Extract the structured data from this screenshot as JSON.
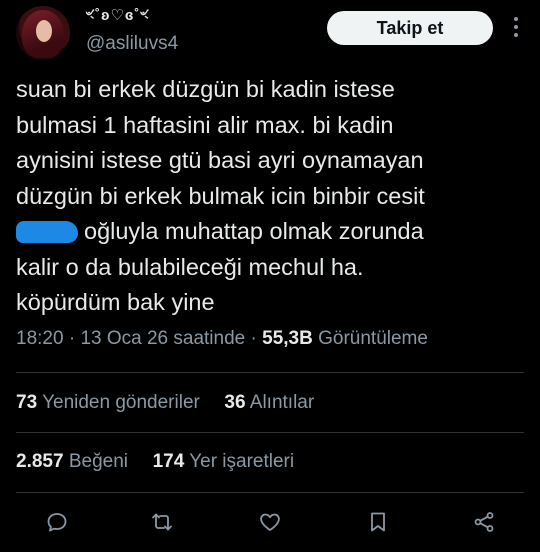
{
  "author": {
    "display_name": "ৼ˚ʚ♡ɞ˚ৼ",
    "handle": "@asliluvs4",
    "follow_label": "Takip et"
  },
  "tweet": {
    "lines": [
      "suan bi erkek düzgün bi kadin istese",
      "bulmasi 1 haftasini alir max. bi kadin",
      "aynisini istese gtü basi ayri oynamayan",
      "düzgün bi erkek bulmak icin binbir cesit",
      "oğluyla muhattap olmak zorunda",
      "kalir o da bulabileceği mechul ha.",
      "köpürdüm bak yine"
    ],
    "redaction_color": "#1e88e5"
  },
  "meta": {
    "time": "18:20",
    "separator": "·",
    "date": "13 Oca 26 saatinde",
    "views_count": "55,3B",
    "views_label": "Görüntüleme"
  },
  "stats": {
    "reposts_count": "73",
    "reposts_label": "Yeniden gönderiler",
    "quotes_count": "36",
    "quotes_label": "Alıntılar",
    "likes_count": "2.857",
    "likes_label": "Beğeni",
    "bookmarks_count": "174",
    "bookmarks_label": "Yer işaretleri"
  },
  "actions": {
    "icons": [
      "reply-icon",
      "repost-icon",
      "like-icon",
      "bookmark-icon",
      "share-icon"
    ]
  },
  "colors": {
    "background": "#000000",
    "text": "#e7e9ea",
    "secondary_text": "#8b98a5",
    "divider": "#2f3336",
    "follow_button_bg": "#eff3f4"
  }
}
